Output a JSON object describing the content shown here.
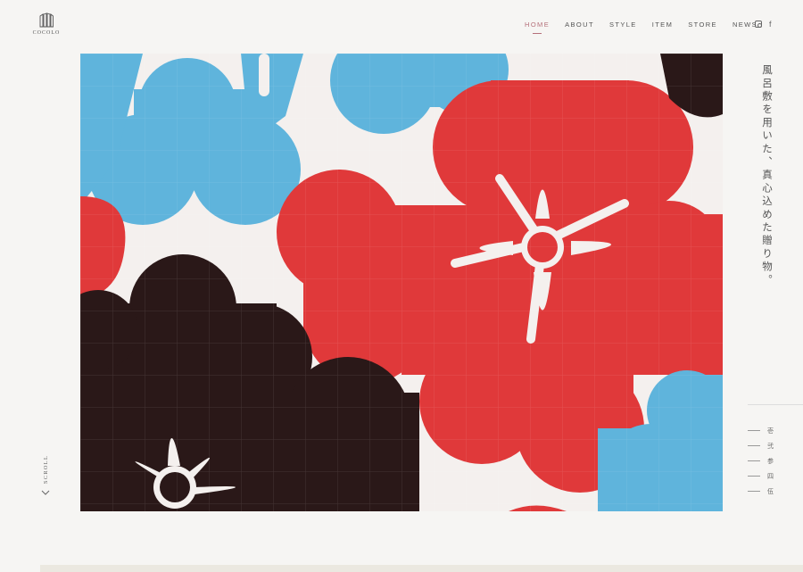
{
  "brand": {
    "name": "COCOLO"
  },
  "nav": {
    "items": [
      {
        "label": "HOME",
        "active": true
      },
      {
        "label": "ABOUT",
        "active": false
      },
      {
        "label": "STYLE",
        "active": false
      },
      {
        "label": "ITEM",
        "active": false
      },
      {
        "label": "STORE",
        "active": false
      },
      {
        "label": "NEWS",
        "active": false
      }
    ]
  },
  "social": {
    "icons": [
      "instagram-icon",
      "facebook-icon"
    ],
    "facebook_glyph": "f"
  },
  "hero": {
    "image": "furoshiki-plum-blossom-pattern",
    "colors": {
      "red": "#e0393a",
      "blue": "#5fb4dc",
      "black": "#2a1818",
      "cloth": "#f4f0ee"
    }
  },
  "tagline": "風呂敷を用いた、真心込めた贈り物。",
  "slides": {
    "items": [
      "壱",
      "弐",
      "参",
      "四",
      "伍"
    ]
  },
  "scroll": {
    "label": "SCROLL"
  },
  "colors": {
    "accent": "#b5707a",
    "background": "#f6f5f3"
  }
}
